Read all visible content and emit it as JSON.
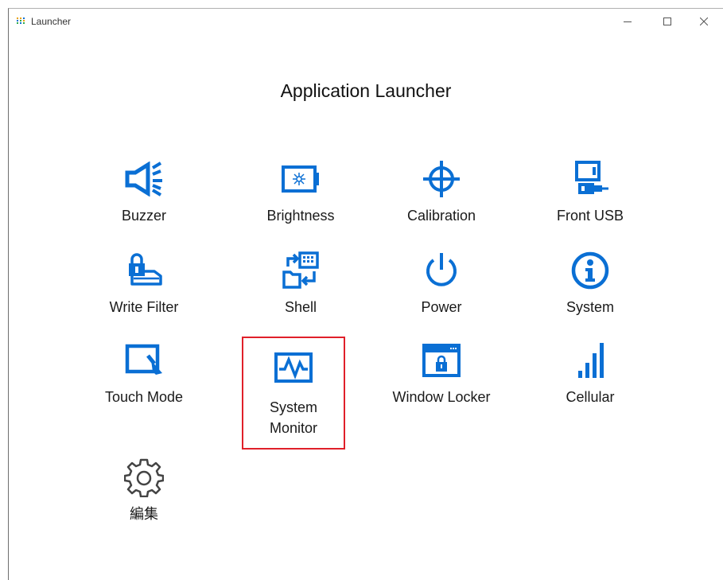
{
  "window": {
    "title": "Launcher",
    "minimize_glyph": "—",
    "maximize_glyph": "☐",
    "close_glyph": "✕"
  },
  "heading": "Application Launcher",
  "accent_color": "#0a6fd4",
  "selection_color": "#e0202a",
  "tiles": [
    {
      "label": "Buzzer",
      "icon": "speaker-icon"
    },
    {
      "label": "Brightness",
      "icon": "brightness-icon"
    },
    {
      "label": "Calibration",
      "icon": "crosshair-icon"
    },
    {
      "label": "Front USB",
      "icon": "usb-icon"
    },
    {
      "label": "Write Filter",
      "icon": "lock-drive-icon"
    },
    {
      "label": "Shell",
      "icon": "shell-swap-icon"
    },
    {
      "label": "Power",
      "icon": "power-icon"
    },
    {
      "label": "System",
      "icon": "info-icon"
    },
    {
      "label": "Touch Mode",
      "icon": "touch-screen-icon"
    },
    {
      "label": "System Monitor",
      "icon": "monitor-graph-icon",
      "selected": true
    },
    {
      "label": "Window Locker",
      "icon": "window-lock-icon"
    },
    {
      "label": "Cellular",
      "icon": "signal-bars-icon"
    },
    {
      "label": "編集",
      "icon": "gear-icon"
    }
  ]
}
